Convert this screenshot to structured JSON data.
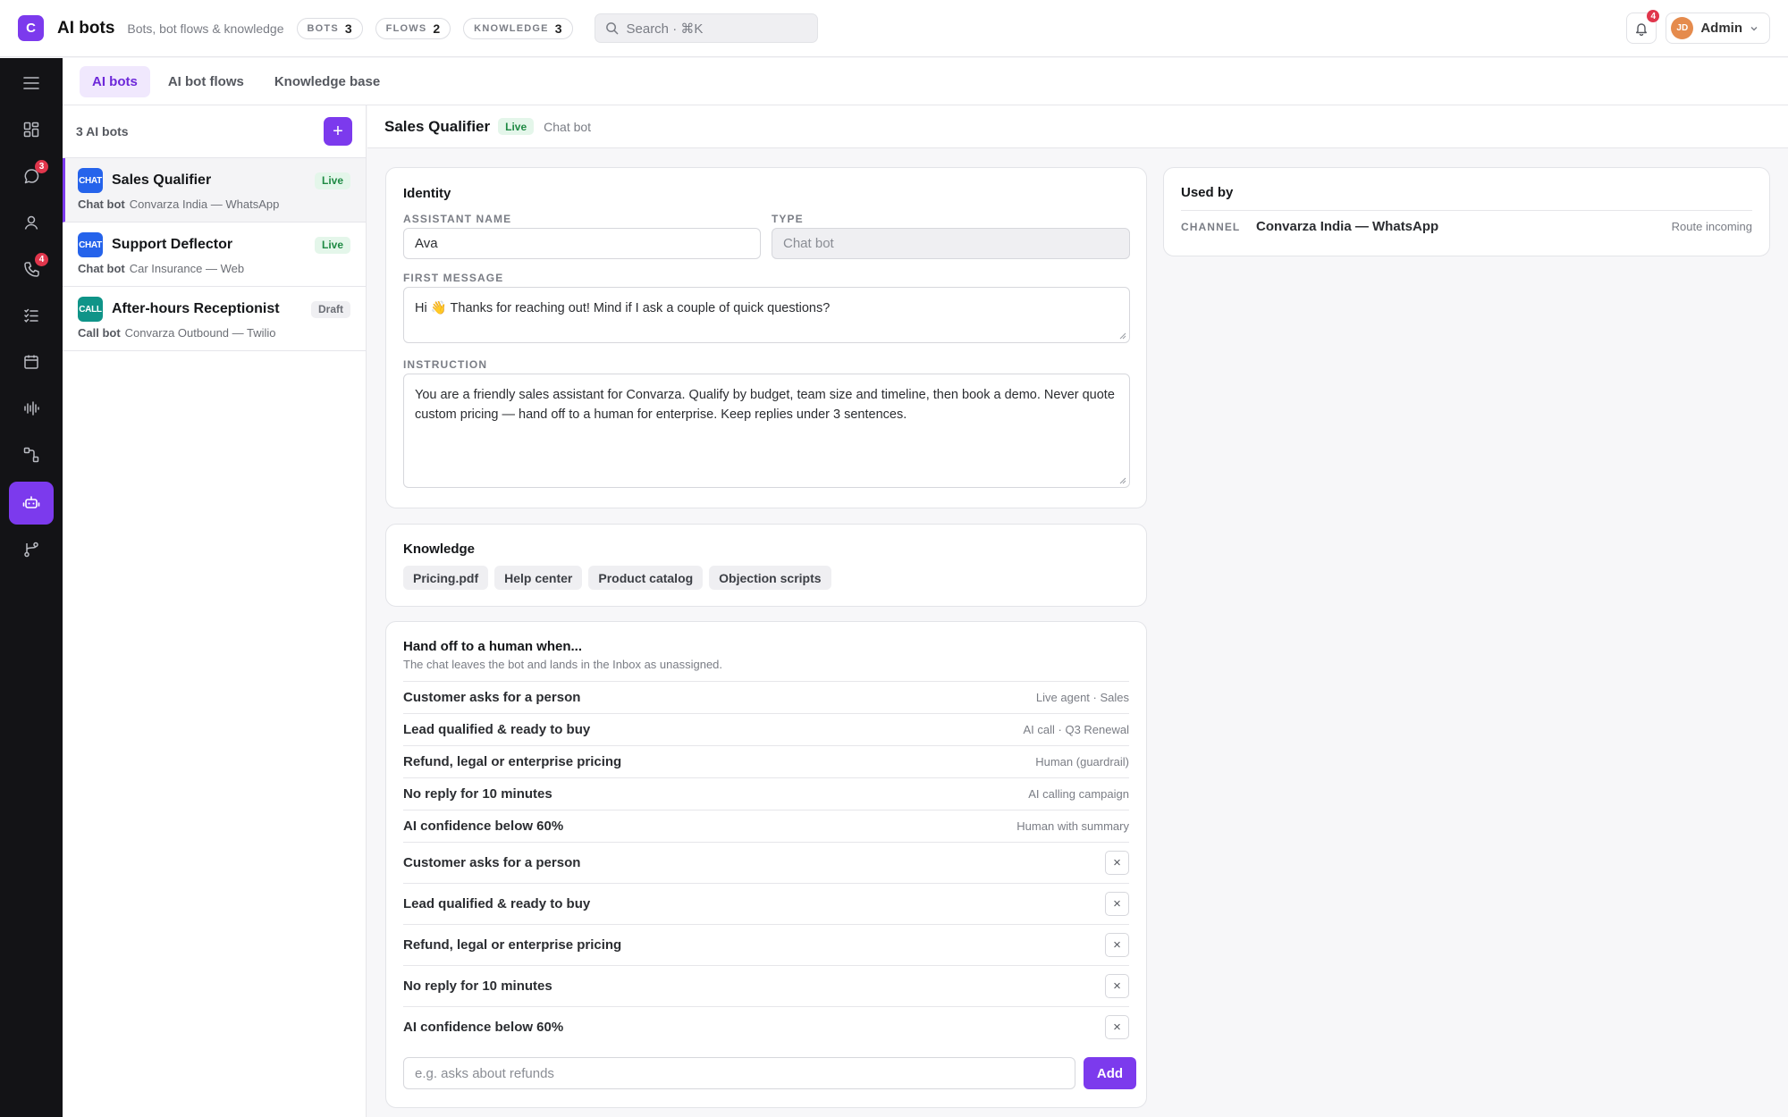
{
  "app": {
    "logo_letter": "C",
    "title": "AI bots",
    "subtitle": "Bots, bot flows & knowledge",
    "pills": [
      {
        "label": "BOTS",
        "count": "3"
      },
      {
        "label": "FLOWS",
        "count": "2"
      },
      {
        "label": "KNOWLEDGE",
        "count": "3"
      }
    ],
    "search_placeholder": "Search · ⌘K",
    "notifications": "4",
    "user_initials": "JD",
    "user_name": "Admin"
  },
  "rail": {
    "items": [
      {
        "icon": "menu-icon"
      },
      {
        "icon": "dashboard-icon"
      },
      {
        "icon": "chat-icon",
        "badge": "3"
      },
      {
        "icon": "user-icon"
      },
      {
        "icon": "phone-icon",
        "badge": "4"
      },
      {
        "icon": "checklist-icon"
      },
      {
        "icon": "calendar-icon"
      },
      {
        "icon": "waveform-icon"
      },
      {
        "icon": "flow-icon"
      },
      {
        "icon": "robot-icon",
        "active": true
      },
      {
        "icon": "branch-icon"
      }
    ]
  },
  "tabs": [
    "AI bots",
    "AI bot flows",
    "Knowledge base"
  ],
  "list": {
    "count_label": "3 AI bots",
    "add_label": "+",
    "bots": [
      {
        "icon_text": "CHAT",
        "icon_color": "#2563eb",
        "name": "Sales Qualifier",
        "status": "Live",
        "type": "Chat bot",
        "channel": "Convarza India — WhatsApp"
      },
      {
        "icon_text": "CHAT",
        "icon_color": "#2563eb",
        "name": "Support Deflector",
        "status": "Live",
        "type": "Chat bot",
        "channel": "Car Insurance — Web"
      },
      {
        "icon_text": "CALL",
        "icon_color": "#0f9488",
        "name": "After-hours Receptionist",
        "status": "Draft",
        "type": "Call bot",
        "channel": "Convarza Outbound — Twilio"
      }
    ]
  },
  "detail": {
    "title": "Sales Qualifier",
    "status": "Live",
    "type": "Chat bot",
    "identity": {
      "title": "Identity",
      "assistant_name_label": "ASSISTANT NAME",
      "assistant_name": "Ava",
      "type_label": "TYPE",
      "type_value": "Chat bot",
      "first_message_label": "FIRST MESSAGE",
      "first_message": "Hi 👋 Thanks for reaching out! Mind if I ask a couple of quick questions?",
      "instruction_label": "INSTRUCTION",
      "instruction": "You are a friendly sales assistant for Convarza. Qualify by budget, team size and timeline, then book a demo. Never quote custom pricing — hand off to a human for enterprise. Keep replies under 3 sentences."
    },
    "knowledge": {
      "title": "Knowledge",
      "items": [
        "Pricing.pdf",
        "Help center",
        "Product catalog",
        "Objection scripts"
      ]
    },
    "handoff": {
      "title": "Hand off to a human when...",
      "subtitle": "The chat leaves the bot and lands in the Inbox as unassigned.",
      "rules": [
        {
          "name": "Customer asks for a person",
          "target": "Live agent · Sales"
        },
        {
          "name": "Lead qualified & ready to buy",
          "target": "AI call · Q3 Renewal"
        },
        {
          "name": "Refund, legal or enterprise pricing",
          "target": "Human (guardrail)"
        },
        {
          "name": "No reply for 10 minutes",
          "target": "AI calling campaign"
        },
        {
          "name": "AI confidence below 60%",
          "target": "Human with summary"
        }
      ],
      "editable": [
        "Customer asks for a person",
        "Lead qualified & ready to buy",
        "Refund, legal or enterprise pricing",
        "No reply for 10 minutes",
        "AI confidence below 60%"
      ],
      "remove_label": "×",
      "add_placeholder": "e.g. asks about refunds",
      "add_button": "Add"
    },
    "used_by": {
      "title": "Used by",
      "kind": "CHANNEL",
      "name": "Convarza India — WhatsApp",
      "action": "Route incoming"
    }
  }
}
